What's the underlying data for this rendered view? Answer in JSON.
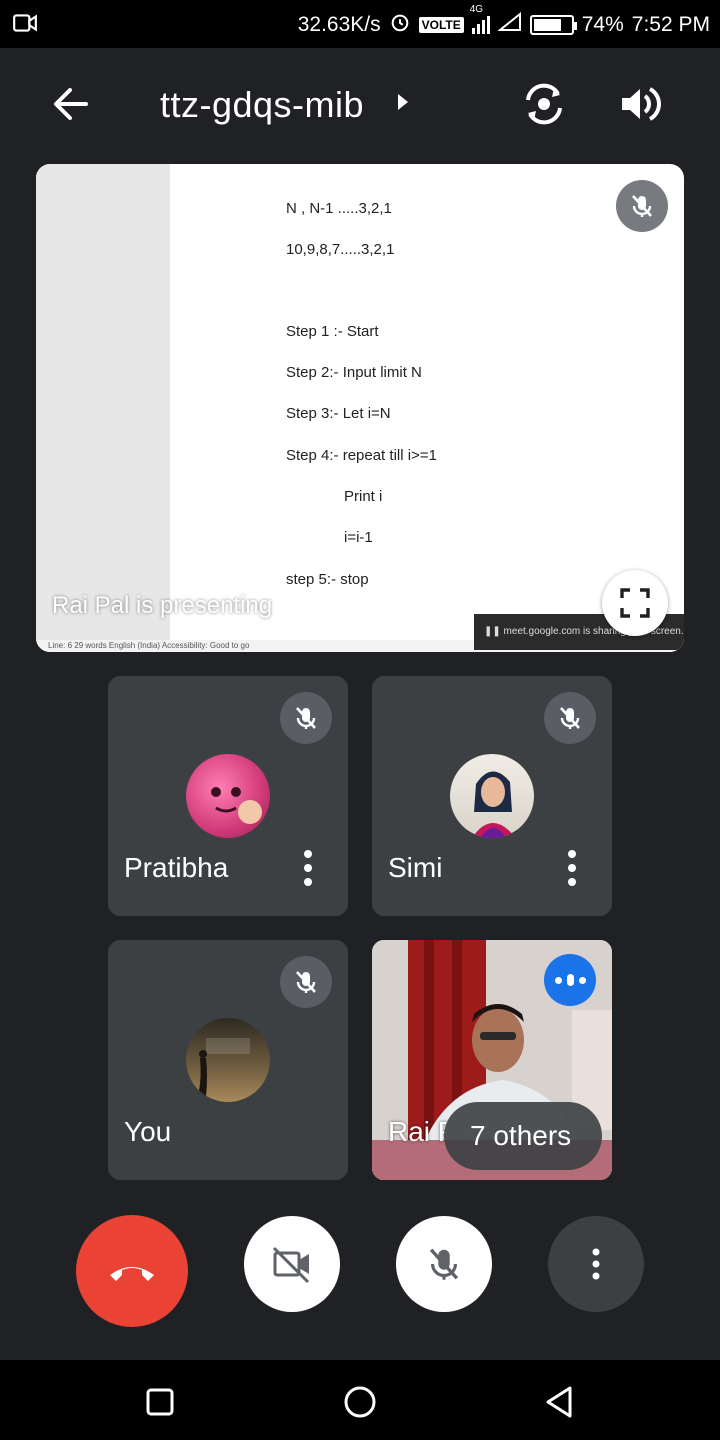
{
  "status_bar": {
    "network_speed": "32.63K/s",
    "volte": "VOLTE",
    "network_type": "4G",
    "battery_percent": "74%",
    "battery_level": 0.74,
    "time": "7:52 PM"
  },
  "header": {
    "meeting_code": "ttz-gdqs-mib",
    "back_icon": "arrow-back-icon",
    "switch_camera_icon": "switch-camera-icon",
    "speaker_icon": "volume-icon"
  },
  "presentation": {
    "presenter_label": "Rai Pal is presenting",
    "share_notice": "meet.google.com is sharing your screen.",
    "doc_status": "Line: 6    29 words    English (India)    Accessibility: Good to go",
    "doc_lines": [
      "N , N-1 .....3,2,1",
      "10,9,8,7.....3,2,1",
      "Step 1 :- Start",
      "Step 2:- Input limit N",
      "Step 3:-  Let i=N",
      "Step 4:- repeat till i>=1",
      "Print i",
      "i=i-1",
      "step 5:- stop"
    ]
  },
  "participants": [
    {
      "name": "Pratibha",
      "muted": true
    },
    {
      "name": "Simi",
      "muted": true
    },
    {
      "name": "You",
      "muted": true
    },
    {
      "name": "Rai P",
      "others_label": "7 others"
    }
  ],
  "controls": {
    "end_call": "end-call-icon",
    "camera": "camera-off-icon",
    "mic": "mic-off-icon",
    "more": "more-vert-icon"
  },
  "colors": {
    "background": "#202124",
    "tile": "#3c4043",
    "end_call": "#ea4335",
    "speaking_badge": "#1a73e8"
  }
}
